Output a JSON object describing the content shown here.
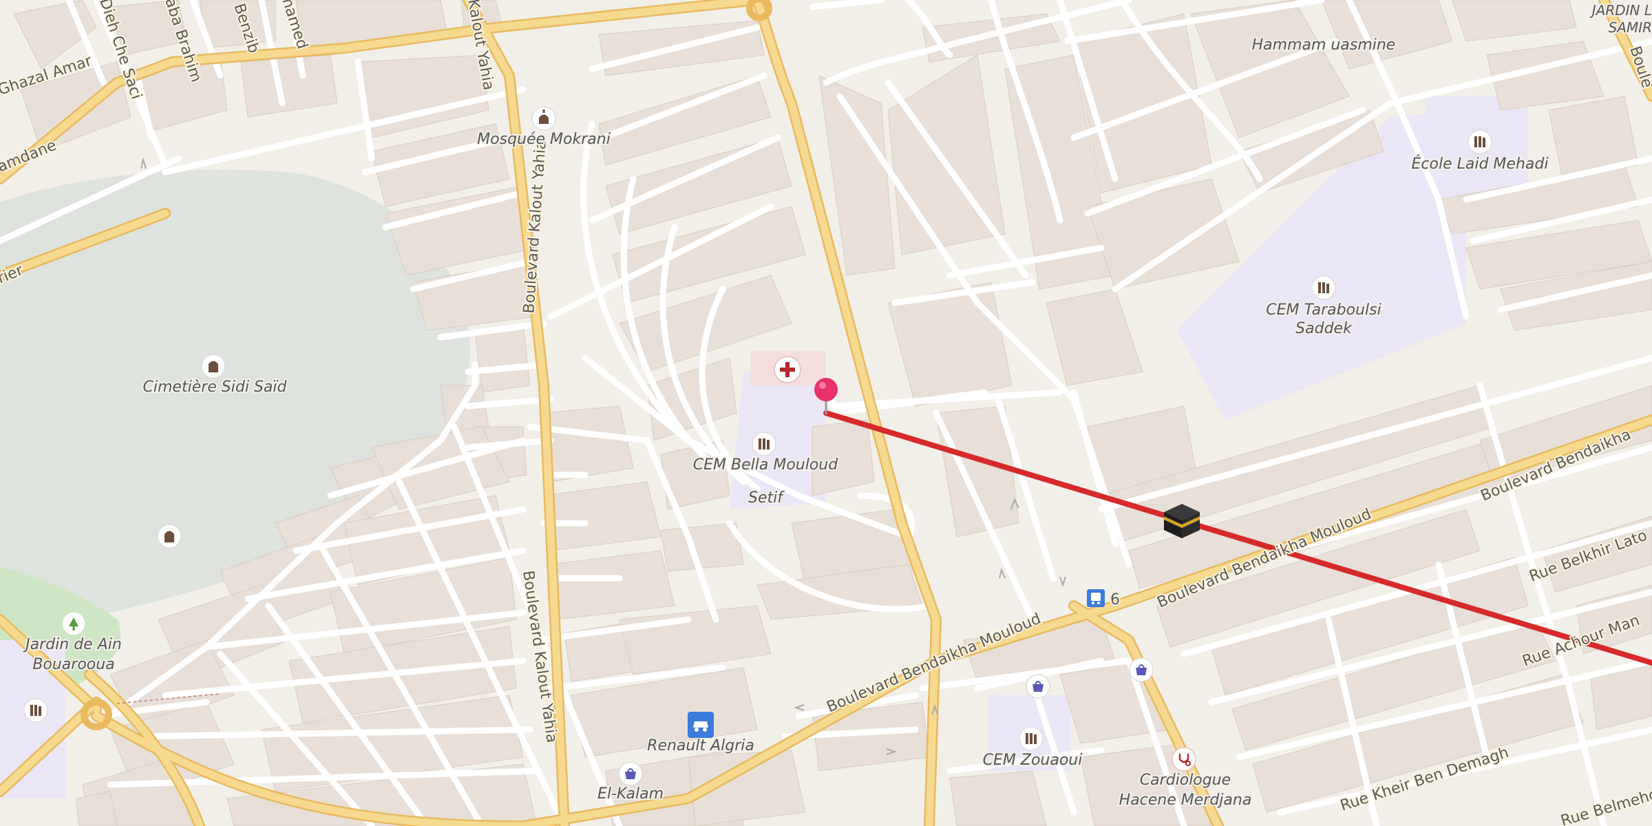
{
  "map": {
    "colors": {
      "background": "#f2efe9",
      "block": "#e8e0d8",
      "building": "#ddd3cb",
      "minor_road": "#ffffff",
      "major_road": "#f7d990",
      "major_road_casing": "#e9b95e",
      "cemetery": "#dfe3de",
      "school_area": "#ebe6f5",
      "park": "#cfe6c4",
      "route_line": "#d62a2a",
      "pin": "#e8306a",
      "poi_icon_fill": "#6b4e3d",
      "shop_icon": "#5b58b8",
      "hospital_icon": "#b3282d",
      "transport_icon": "#3b7bdb"
    },
    "labels": {
      "mosque": "Mosquée Mokrani",
      "cemetery": "Cimetière Sidi Saïd",
      "school1_line1": "CEM Bella Mouloud",
      "school1_line2": "Setif",
      "school2_line1": "CEM Taraboulsi",
      "school2_line2": "Saddek",
      "school3": "École Laid Mehadi",
      "school4": "CEM Zouaoui",
      "hammam": "Hammam uasmine",
      "garden_line1": "Jardin de Ain",
      "garden_line2": "Bouarooua",
      "jardin_corner_line1": "JARDIN L",
      "jardin_corner_line2": "SAMIR",
      "renault": "Renault Algria",
      "elkalam": "El-Kalam",
      "cardio_line1": "Cardiologue",
      "cardio_line2": "Hacene Merdjana",
      "bus_stop": "6"
    },
    "roads": {
      "kalout1": "Kalout Yahia",
      "kalout2": "Boulevard Kalout Yahia",
      "kalout3": "Boulevard Kalout Yahia",
      "bendaikha1": "Boulevard Bendaikha Mouloud",
      "bendaikha2": "Boulevard Bendaikha Mouloud",
      "bendaikha3": "Boulevard Bendaikha",
      "belkhir": "Rue Belkhir Lato",
      "achour": "Rue Achour Man",
      "kheir": "Rue Kheir Ben Demagh",
      "belmehdi": "Rue Belmehdi",
      "ghazal": "Ghazal Amar",
      "dieh": "Dieh Che Saci",
      "brahim": "aba Brahim",
      "benzib": "Benzib",
      "hamed": "hamed",
      "hamdane": "amdane",
      "rier": "rier",
      "boule_top": "Boule"
    }
  }
}
